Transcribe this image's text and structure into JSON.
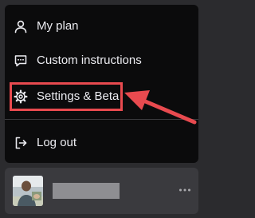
{
  "menu": {
    "items": [
      {
        "label": "My plan",
        "icon": "person-icon"
      },
      {
        "label": "Custom instructions",
        "icon": "chat-bubble-icon"
      },
      {
        "label": "Settings & Beta",
        "icon": "gear-icon"
      },
      {
        "label": "Log out",
        "icon": "logout-icon"
      }
    ]
  },
  "annotation": {
    "highlighted_item": "Settings & Beta",
    "color": "#e84a4f"
  },
  "user": {
    "avatar": "avatar-photo",
    "name": "",
    "more_icon": "ellipsis-icon"
  },
  "colors": {
    "menu_bg": "#0b0b0c",
    "page_bg": "#2b2b2e",
    "text": "#ececf1"
  }
}
